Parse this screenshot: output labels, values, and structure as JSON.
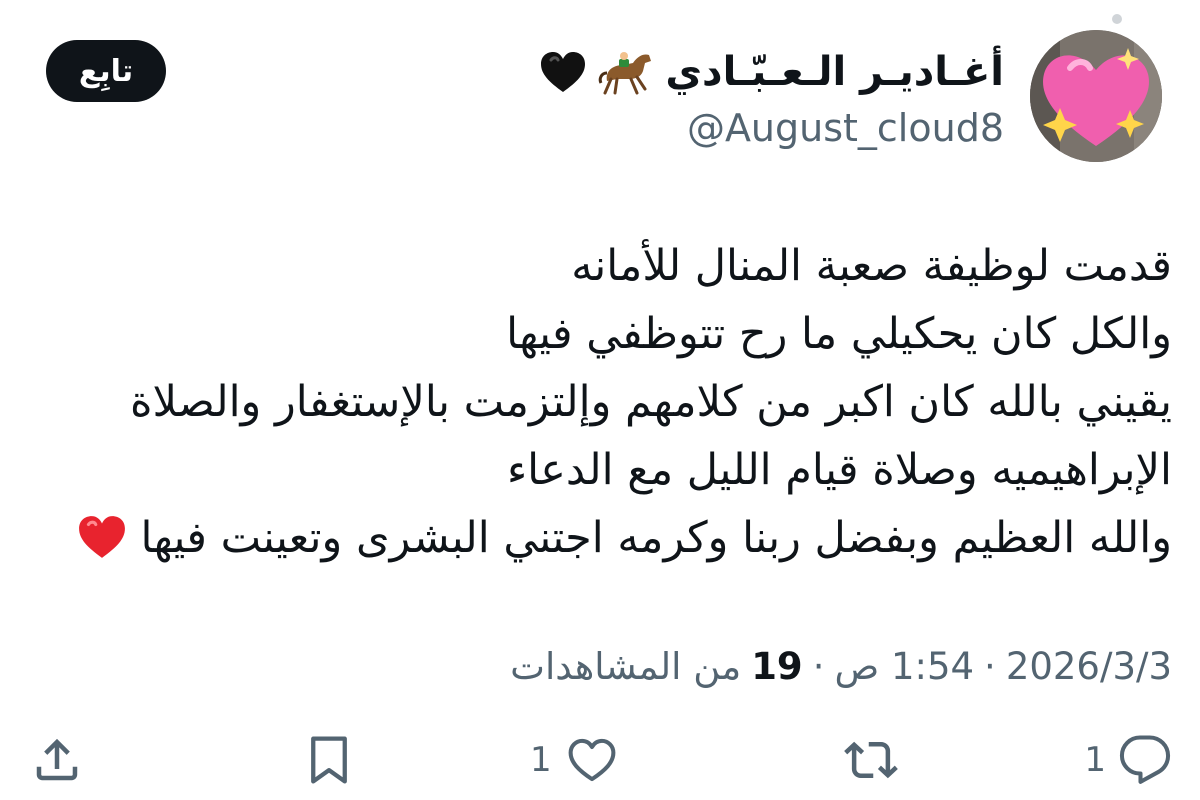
{
  "header": {
    "display_name": "أغـاديـر الـعـبّـادي",
    "handle": "@August_cloud8",
    "follow_label": "تابِع",
    "name_emojis": [
      "horse-racing-icon",
      "black-heart-icon"
    ]
  },
  "tweet": {
    "lines": [
      "قدمت لوظيفة صعبة المنال للأمانه",
      "والكل كان يحكيلي ما رح تتوظفي فيها",
      "يقيني بالله كان اكبر من كلامهم وإلتزمت بالإستغفار والصلاة",
      "الإبراهيميه وصلاة قيام الليل مع الدعاء",
      "والله العظيم وبفضل ربنا وكرمه اجتني البشرى وتعينت فيها"
    ],
    "trailing_emoji": "red-heart-icon"
  },
  "meta": {
    "time": "1:54 ص",
    "separator": "·",
    "date": "2026/3/3",
    "views_count": "19",
    "views_label": "من المشاهدات"
  },
  "actions": {
    "reply_count": "1",
    "like_count": "1"
  },
  "colors": {
    "text": "#0f1419",
    "secondary": "#536471",
    "button_bg": "#0f1419",
    "heart_red": "#e0245e"
  }
}
